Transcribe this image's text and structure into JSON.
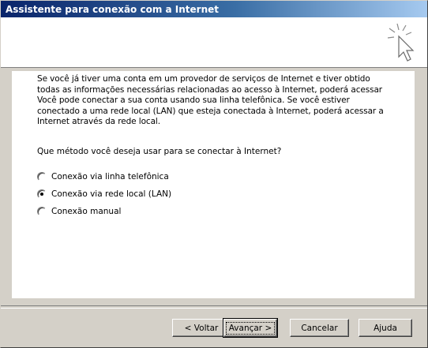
{
  "window": {
    "title": "Assistente para conexão com a Internet"
  },
  "header": {
    "icon": "wizard-cursor-icon"
  },
  "content": {
    "description": "Se você já tiver uma conta em um provedor de serviços de Internet e tiver obtido todas as informações necessárias relacionadas ao acesso à Internet, poderá acessar Você pode conectar a sua conta usando sua linha telefônica. Se você estiver conectado a uma rede local (LAN) que esteja conectada à Internet, poderá acessar a Internet através da rede local.",
    "question": "Que método você deseja usar para se conectar à Internet?",
    "options": [
      {
        "label": "Conexão via linha telefônica",
        "checked": false
      },
      {
        "label": "Conexão via rede local (LAN)",
        "checked": true
      },
      {
        "label": "Conexão manual",
        "checked": false
      }
    ]
  },
  "buttons": {
    "back": "< Voltar",
    "next": "Avançar >",
    "cancel": "Cancelar",
    "help": "Ajuda"
  },
  "colors": {
    "titlebar_start": "#0a246a",
    "titlebar_end": "#a6caf0",
    "face": "#d4d0c8"
  }
}
